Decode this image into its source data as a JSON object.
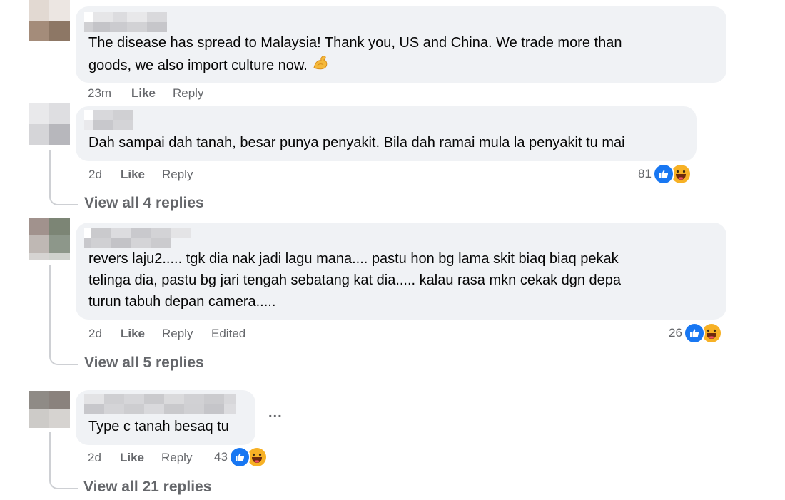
{
  "comments": [
    {
      "text_lines": [
        "The disease has spread to Malaysia! Thank you, US and China. We trade more than",
        "goods, we also import culture now."
      ],
      "emoji": "flexed-biceps",
      "time": "23m",
      "like": "Like",
      "reply": "Reply"
    },
    {
      "text_lines": [
        "Dah sampai dah tanah, besar punya penyakit. Bila dah ramai mula la penyakit tu mai"
      ],
      "time": "2d",
      "like": "Like",
      "reply": "Reply",
      "reaction_count": "81",
      "reactions": [
        "like-icon",
        "haha-icon"
      ],
      "view_replies": "View all 4 replies"
    },
    {
      "text_lines": [
        "revers laju2..... tgk dia nak jadi lagu mana.... pastu hon bg lama skit biaq biaq pekak",
        "telinga dia, pastu bg jari tengah sebatang kat dia..... kalau rasa mkn cekak dgn depa",
        "turun tabuh depan camera....."
      ],
      "time": "2d",
      "like": "Like",
      "reply": "Reply",
      "edited": "Edited",
      "reaction_count": "26",
      "reactions": [
        "like-icon",
        "haha-icon"
      ],
      "view_replies": "View all 5 replies"
    },
    {
      "text_lines": [
        "Type c tanah besaq tu"
      ],
      "time": "2d",
      "like": "Like",
      "reply": "Reply",
      "reaction_count": "43",
      "reactions": [
        "like-icon",
        "haha-icon"
      ],
      "more_options": "...",
      "view_replies": "View all 21 replies"
    }
  ],
  "colors": {
    "bubble": "#f0f2f5",
    "meta_text": "#65676b",
    "like_blue": "#1877f2",
    "haha_yellow": "#f7b125",
    "thread_line": "#ced0d4"
  }
}
